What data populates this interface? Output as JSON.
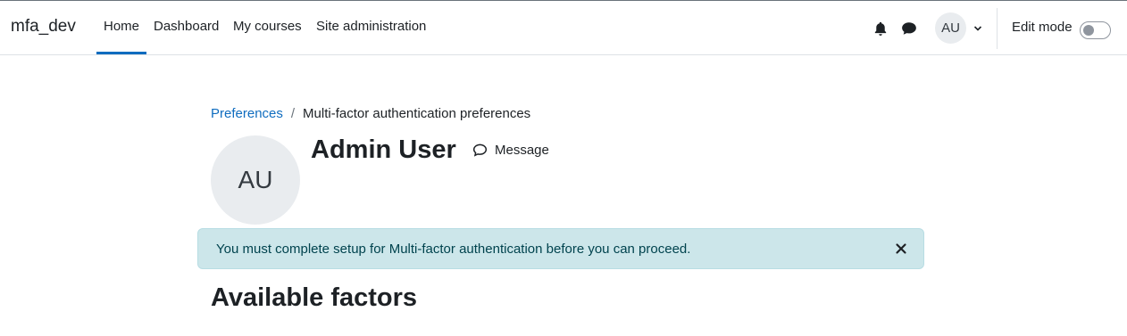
{
  "navbar": {
    "brand": "mfa_dev",
    "links": [
      {
        "label": "Home",
        "active": true
      },
      {
        "label": "Dashboard",
        "active": false
      },
      {
        "label": "My courses",
        "active": false
      },
      {
        "label": "Site administration",
        "active": false
      }
    ],
    "user_initials": "AU",
    "edit_mode_label": "Edit mode",
    "edit_mode_on": false,
    "icons": [
      "bell-icon",
      "chat-icon",
      "chevron-down-icon"
    ]
  },
  "breadcrumb": {
    "parent": "Preferences",
    "separator": "/",
    "current": "Multi-factor authentication preferences"
  },
  "profile": {
    "initials": "AU",
    "name": "Admin User",
    "message_label": "Message"
  },
  "alert": {
    "text": "You must complete setup for Multi-factor authentication before you can proceed.",
    "close_icon": "close-icon"
  },
  "section": {
    "heading": "Available factors"
  },
  "colors": {
    "accent": "#0f6cbf",
    "alert_bg": "#cce6ea",
    "alert_text": "#00434e",
    "avatar_bg": "#e9ecef"
  }
}
